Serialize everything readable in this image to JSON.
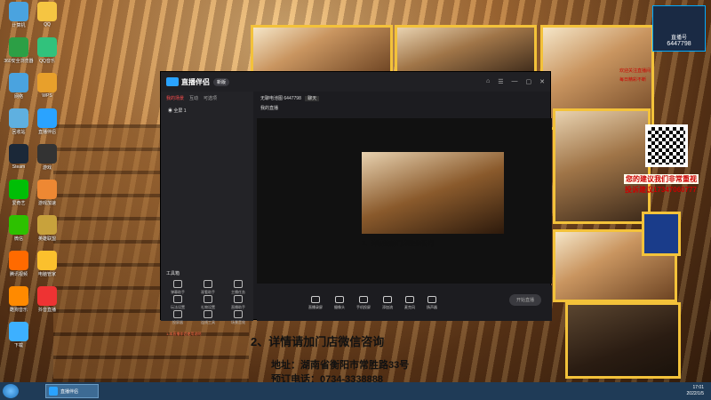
{
  "desktop": {
    "icons": [
      {
        "label": "计算机",
        "color": "#4aa3df"
      },
      {
        "label": "QQ",
        "color": "#f5c542"
      },
      {
        "label": "360安全浏览器",
        "color": "#2c9f45"
      },
      {
        "label": "QQ音乐",
        "color": "#31c27c"
      },
      {
        "label": "网络",
        "color": "#4aa3df"
      },
      {
        "label": "WPS",
        "color": "#e8a02b"
      },
      {
        "label": "回收站",
        "color": "#5fb0e0"
      },
      {
        "label": "直播伴侣",
        "color": "#2aa3ff"
      },
      {
        "label": "Steam",
        "color": "#1b2838"
      },
      {
        "label": "游戏",
        "color": "#333"
      },
      {
        "label": "爱奇艺",
        "color": "#00be06"
      },
      {
        "label": "游戏加速",
        "color": "#e83"
      },
      {
        "label": "微信",
        "color": "#2dc100"
      },
      {
        "label": "英雄联盟",
        "color": "#c8a23c"
      },
      {
        "label": "腾讯视频",
        "color": "#ff6a00"
      },
      {
        "label": "电脑管家",
        "color": "#fbc02d"
      },
      {
        "label": "酷狗音乐",
        "color": "#ff8a00"
      },
      {
        "label": "抖音直播",
        "color": "#e33"
      },
      {
        "label": "下载",
        "color": "#3db0ff"
      }
    ]
  },
  "app": {
    "name": "直播伴侣",
    "version": "新版",
    "tabs": [
      "我的场景",
      "互动",
      "可选项"
    ],
    "scene_label": "全屏 1",
    "room_title": "无聊电池图 6447798",
    "room_tag": "聊天",
    "room_sub": "我的直播",
    "tools_title": "工具箱",
    "tools": [
      {
        "label": "弹幕助手"
      },
      {
        "label": "观看助手"
      },
      {
        "label": "主播任务"
      },
      {
        "label": "玩法设置"
      },
      {
        "label": "礼物设置"
      },
      {
        "label": "直播助手"
      },
      {
        "label": "投屏器"
      },
      {
        "label": "连线工具"
      },
      {
        "label": "场景音效"
      }
    ],
    "tip": "1.本直播伴侣使用说明",
    "bottom_buttons": [
      {
        "label": "直播录屏"
      },
      {
        "label": "摄像头"
      },
      {
        "label": "手机投屏"
      },
      {
        "label": "添加流"
      },
      {
        "label": "麦克风"
      },
      {
        "label": "扬声器"
      }
    ],
    "live_button": "开始直播",
    "window_controls": [
      "⌂",
      "☰",
      "—",
      "▢",
      "✕"
    ]
  },
  "overlay": {
    "consult": "2、详情请加门店微信咨询",
    "address": "地址：湖南省衡阳市常胜路33号",
    "phone": "预订电话：0734-3338888",
    "mini_consult": "2、详情请加门店微信咨询"
  },
  "promo": {
    "brand_name": "直播号",
    "brand_id": "6447798",
    "top_line": "欢迎关注直播间",
    "sub_line": "每日精彩不断",
    "advice_line1": "您的建议我们非常重视",
    "advice_line2": "投诉建议17347060777"
  },
  "taskbar": {
    "task_label": "直播伴侣",
    "time": "17:01",
    "date": "2022/1/5"
  }
}
